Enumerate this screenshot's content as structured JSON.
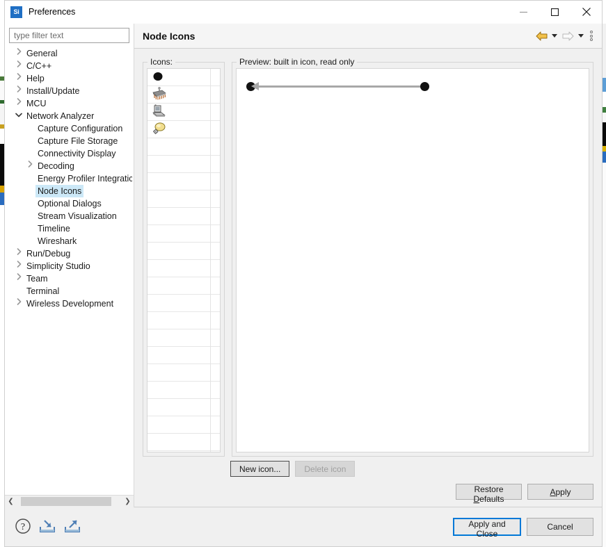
{
  "window": {
    "title": "Preferences",
    "app_icon_label": "Si",
    "controls": {
      "minimize": "minimize-icon",
      "maximize": "maximize-icon",
      "close": "close-icon"
    }
  },
  "filter": {
    "placeholder": "type filter text",
    "value": ""
  },
  "tree": {
    "items": [
      {
        "label": "General",
        "level": 0,
        "arrow": "collapsed",
        "selected": false
      },
      {
        "label": "C/C++",
        "level": 0,
        "arrow": "collapsed",
        "selected": false
      },
      {
        "label": "Help",
        "level": 0,
        "arrow": "collapsed",
        "selected": false
      },
      {
        "label": "Install/Update",
        "level": 0,
        "arrow": "collapsed",
        "selected": false
      },
      {
        "label": "MCU",
        "level": 0,
        "arrow": "collapsed",
        "selected": false
      },
      {
        "label": "Network Analyzer",
        "level": 0,
        "arrow": "expanded",
        "selected": false
      },
      {
        "label": "Capture Configuration",
        "level": 1,
        "arrow": "none",
        "selected": false
      },
      {
        "label": "Capture File Storage",
        "level": 1,
        "arrow": "none",
        "selected": false
      },
      {
        "label": "Connectivity Display",
        "level": 1,
        "arrow": "none",
        "selected": false
      },
      {
        "label": "Decoding",
        "level": 1,
        "arrow": "collapsed",
        "selected": false
      },
      {
        "label": "Energy Profiler Integratic",
        "level": 1,
        "arrow": "none",
        "selected": false
      },
      {
        "label": "Node Icons",
        "level": 1,
        "arrow": "none",
        "selected": true
      },
      {
        "label": "Optional Dialogs",
        "level": 1,
        "arrow": "none",
        "selected": false
      },
      {
        "label": "Stream Visualization",
        "level": 1,
        "arrow": "none",
        "selected": false
      },
      {
        "label": "Timeline",
        "level": 1,
        "arrow": "none",
        "selected": false
      },
      {
        "label": "Wireshark",
        "level": 1,
        "arrow": "none",
        "selected": false
      },
      {
        "label": "Run/Debug",
        "level": 0,
        "arrow": "collapsed",
        "selected": false
      },
      {
        "label": "Simplicity Studio",
        "level": 0,
        "arrow": "collapsed",
        "selected": false
      },
      {
        "label": "Team",
        "level": 0,
        "arrow": "collapsed",
        "selected": false
      },
      {
        "label": "Terminal",
        "level": 0,
        "arrow": "none",
        "selected": false
      },
      {
        "label": "Wireless Development",
        "level": 0,
        "arrow": "collapsed",
        "selected": false
      }
    ],
    "scrollbar": {
      "left_arrow": "chevron-left-icon",
      "right_arrow": "chevron-right-icon"
    }
  },
  "page": {
    "title": "Node Icons",
    "toolbar": {
      "back": "back-arrow-icon",
      "back_menu": "chevron-down-icon",
      "forward": "forward-arrow-icon",
      "forward_menu": "chevron-down-icon",
      "more": "view-menu-icon"
    },
    "icons_group": {
      "legend": "Icons:",
      "rows": [
        {
          "icon": "black-dot-icon"
        },
        {
          "icon": "microchip-icon"
        },
        {
          "icon": "laptop-icon"
        },
        {
          "icon": "lightbulb-icon"
        }
      ],
      "empty_row_count": 20
    },
    "preview_group": {
      "legend": "Preview: built in icon, read only",
      "nodes": 2,
      "link_direction": "left",
      "node_color": "#121212",
      "link_color": "#a8a8a8"
    },
    "icon_buttons": {
      "new_icon": "New icon...",
      "delete_icon": "Delete icon",
      "delete_icon_enabled": false
    },
    "footer_buttons": {
      "restore_defaults_pre": "Restore ",
      "restore_defaults_key": "D",
      "restore_defaults_post": "efaults",
      "apply_key": "A",
      "apply_post": "pply"
    }
  },
  "dialog_footer": {
    "icons": {
      "help": "help-icon",
      "import": "import-icon",
      "export": "export-icon"
    },
    "apply_and_close": "Apply and Close",
    "cancel": "Cancel"
  }
}
